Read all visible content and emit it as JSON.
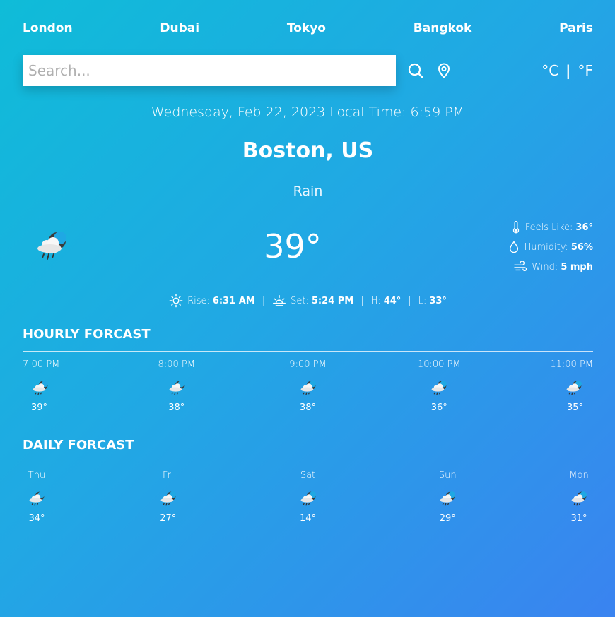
{
  "nav": {
    "cities": [
      "London",
      "Dubai",
      "Tokyo",
      "Bangkok",
      "Paris"
    ]
  },
  "search": {
    "placeholder": "Search...",
    "value": ""
  },
  "units": {
    "celsius": "°C",
    "separator": "|",
    "fahrenheit": "°F"
  },
  "current": {
    "date_line": "Wednesday, Feb 22, 2023 Local Time: 6:59 PM",
    "city": "Boston, US",
    "condition": "Rain",
    "temperature": "39°",
    "icon": "cloud-rain-moon-icon",
    "feels_like_label": "Feels Like:",
    "feels_like": "36°",
    "humidity_label": "Humidity:",
    "humidity": "56%",
    "wind_label": "Wind:",
    "wind": "5 mph",
    "rise_label": "Rise:",
    "rise": "6:31 AM",
    "set_label": "Set:",
    "set": "5:24 PM",
    "high_label": "H:",
    "high": "44°",
    "low_label": "L:",
    "low": "33°",
    "separator": "|"
  },
  "hourly": {
    "title": "HOURLY FORCAST",
    "items": [
      {
        "label": "7:00 PM",
        "temp": "39°",
        "icon": "cloud-rain-moon-icon"
      },
      {
        "label": "8:00 PM",
        "temp": "38°",
        "icon": "cloud-rain-moon-icon"
      },
      {
        "label": "9:00 PM",
        "temp": "38°",
        "icon": "cloud-rain-moon-icon"
      },
      {
        "label": "10:00 PM",
        "temp": "36°",
        "icon": "cloud-rain-moon-icon"
      },
      {
        "label": "11:00 PM",
        "temp": "35°",
        "icon": "cloud-rain-moon-icon"
      }
    ]
  },
  "daily": {
    "title": "DAILY FORCAST",
    "items": [
      {
        "label": "Thu",
        "temp": "34°",
        "icon": "cloud-rain-moon-icon"
      },
      {
        "label": "Fri",
        "temp": "27°",
        "icon": "cloud-rain-moon-icon"
      },
      {
        "label": "Sat",
        "temp": "14°",
        "icon": "cloud-rain-moon-icon"
      },
      {
        "label": "Sun",
        "temp": "29°",
        "icon": "cloud-rain-moon-icon"
      },
      {
        "label": "Mon",
        "temp": "31°",
        "icon": "cloud-rain-moon-icon"
      }
    ]
  },
  "colors": {
    "gradient_start": "#0fbcd8",
    "gradient_end": "#3a83f0",
    "text": "#ffffff"
  }
}
